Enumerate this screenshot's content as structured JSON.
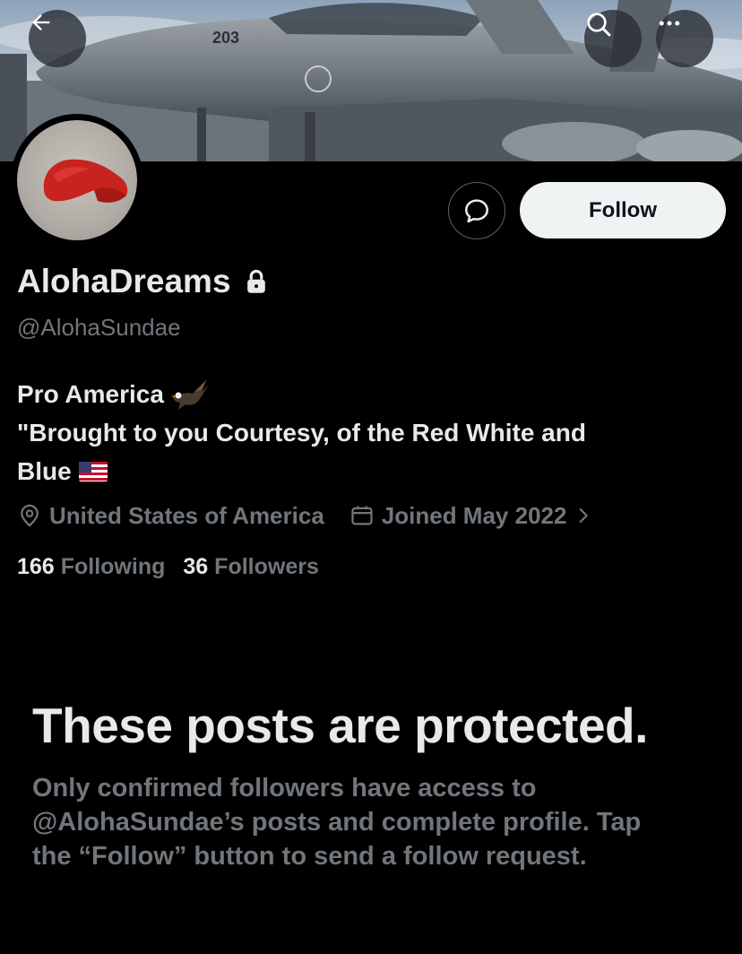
{
  "header": {
    "back_icon": "arrow-left-icon",
    "search_icon": "search-icon",
    "more_icon": "more-horizontal-icon",
    "banner_tail_number": "203"
  },
  "profile": {
    "display_name": "AlohaDreams",
    "protected_icon": "lock-icon",
    "handle": "@AlohaSundae",
    "bio_line1": "Pro America",
    "bio_line1_emoji": "eagle-emoji",
    "bio_line2": "\"Brought to you Courtesy, of the Red White and",
    "bio_line3": "Blue",
    "bio_line3_emoji": "us-flag-emoji",
    "location": "United States of America",
    "joined": "Joined May 2022",
    "following_count": "166",
    "following_label": "Following",
    "followers_count": "36",
    "followers_label": "Followers"
  },
  "actions": {
    "message_icon": "message-bubble-icon",
    "follow_label": "Follow"
  },
  "protected_notice": {
    "title": "These posts are protected.",
    "line1": "Only confirmed followers have access to",
    "line2": "@AlohaSundae’s posts and complete profile. Tap",
    "line3": "the “Follow” button to send a follow request."
  },
  "colors": {
    "background": "#000000",
    "primary_text": "#e7e9ea",
    "secondary_text": "#71767b",
    "follow_button_bg": "#eff3f4"
  }
}
